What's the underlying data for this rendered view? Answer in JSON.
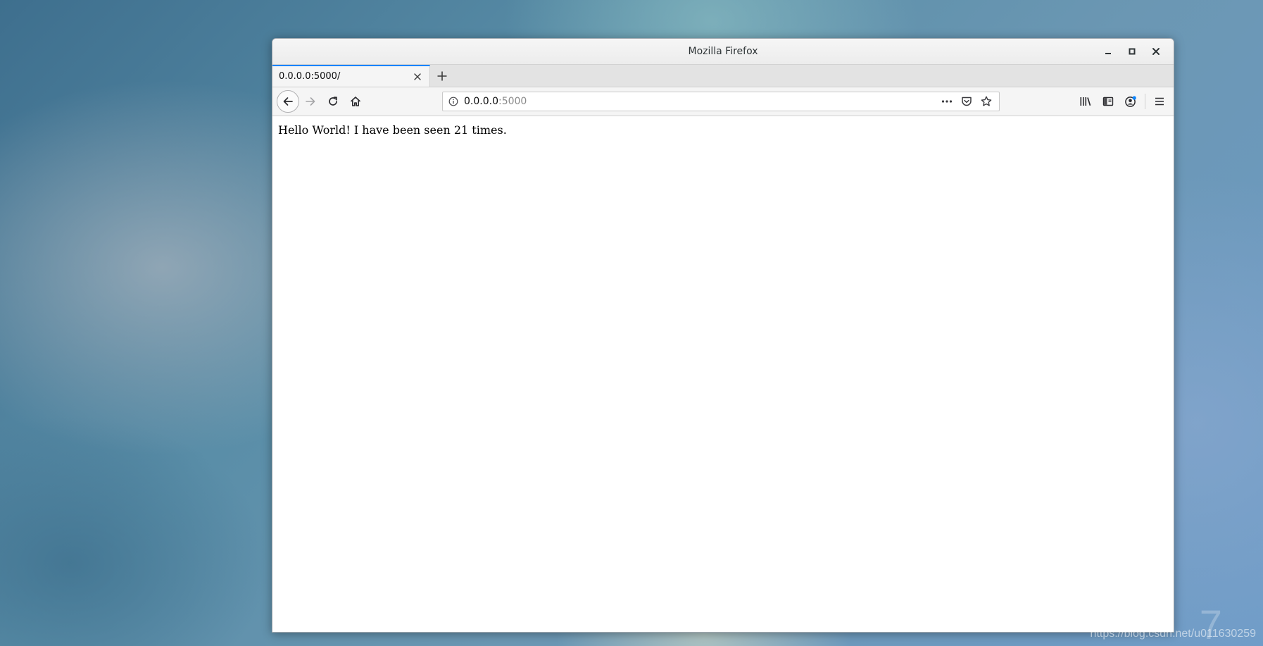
{
  "window": {
    "title": "Mozilla Firefox",
    "controls": [
      "minimize-icon",
      "maximize-icon",
      "close-icon"
    ]
  },
  "tabs": [
    {
      "label": "0.0.0.0:5000/",
      "active": true
    }
  ],
  "navbar": {
    "url_host": "0.0.0.0",
    "url_port": ":5000",
    "icons": {
      "back": "arrow-left-icon",
      "forward": "arrow-right-icon",
      "reload": "reload-icon",
      "home": "home-icon",
      "info": "info-icon",
      "page_actions": "more-horizontal-icon",
      "pocket": "pocket-icon",
      "bookmark": "star-icon",
      "library": "library-icon",
      "sidebar": "sidebar-icon",
      "account": "account-icon",
      "menu": "hamburger-menu-icon"
    }
  },
  "page": {
    "body_text": "Hello World! I have been seen 21 times."
  },
  "desktop": {
    "watermark": "https://blog.csdn.net/u011630259",
    "watermark_glyph": "7"
  },
  "colors": {
    "tab_accent": "#0a84ff",
    "account_badge": "#0a84ff",
    "chrome_bg": "#f5f5f5",
    "tabstrip_bg": "#e3e3e3"
  }
}
